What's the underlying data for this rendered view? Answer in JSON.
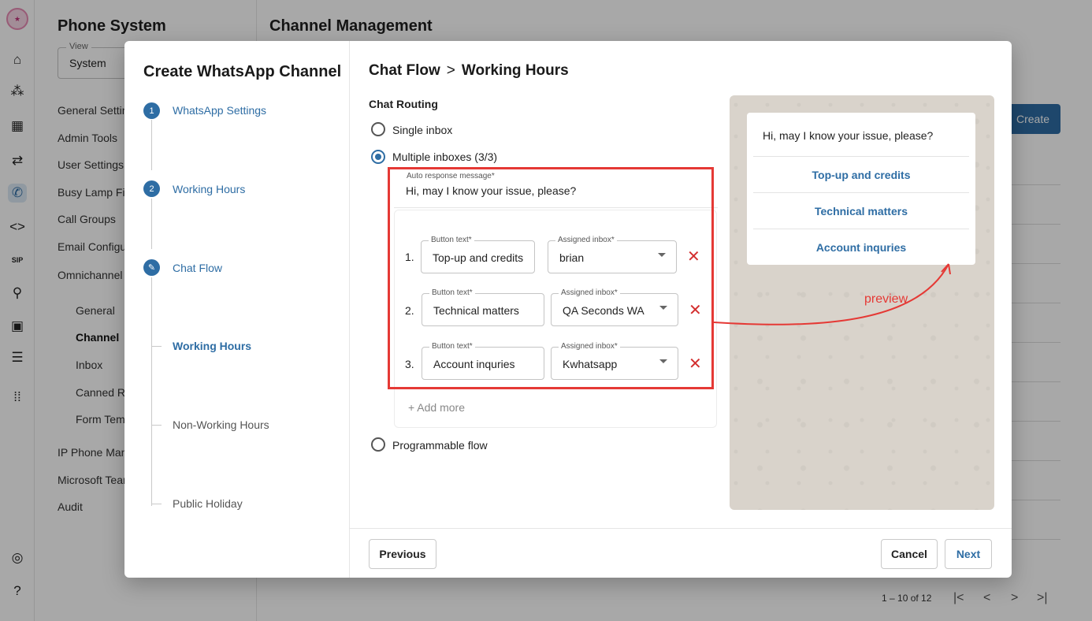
{
  "app": {
    "rail_icons": [
      "logo-icon",
      "home-icon",
      "nodes-icon",
      "dashboard-icon",
      "transfer-icon",
      "phone-icon",
      "code-icon",
      "sip-icon",
      "antenna-icon",
      "contact-icon",
      "server-icon",
      "apps-icon",
      "broadcast-icon",
      "help-icon"
    ],
    "sip_label": "SIP",
    "panel_title": "Phone System",
    "view": {
      "label": "View",
      "value": "System"
    },
    "nav_items": [
      "General Settings",
      "Admin Tools",
      "User Settings",
      "Busy Lamp Field",
      "Call Groups",
      "Email Configuration",
      "Omnichannel"
    ],
    "omnichannel_sub": [
      "General",
      "Channel",
      "Inbox",
      "Canned Responses",
      "Form Templates"
    ],
    "nav_items_after": [
      "IP Phone Management",
      "Microsoft Teams",
      "Audit"
    ],
    "main_title": "Channel Management",
    "create_label": "Create",
    "pager": {
      "range": "1 – 10 of 12",
      "first": "|<",
      "prev": "<",
      "next": ">",
      "last": ">|"
    }
  },
  "modal": {
    "title": "Create WhatsApp Channel",
    "steps": [
      {
        "num": "1",
        "label": "WhatsApp Settings"
      },
      {
        "num": "2",
        "label": "Working Hours"
      },
      {
        "num": "✎",
        "label": "Chat Flow"
      }
    ],
    "substeps": [
      "Working Hours",
      "Non-Working Hours",
      "Public Holiday"
    ],
    "breadcrumb": {
      "parent": "Chat Flow",
      "separator": ">",
      "current": "Working Hours"
    },
    "section_title": "Chat Routing",
    "options": {
      "single": "Single inbox",
      "multiple": "Multiple inboxes (3/3)",
      "programmable": "Programmable flow"
    },
    "auto_response": {
      "label": "Auto response message*",
      "value": "Hi, may I know your issue, please?"
    },
    "button_text_label": "Button text*",
    "assigned_inbox_label": "Assigned inbox*",
    "rows": [
      {
        "num": "1.",
        "text": "Top-up and credits",
        "inbox": "brian"
      },
      {
        "num": "2.",
        "text": "Technical matters",
        "inbox": "QA Seconds WA"
      },
      {
        "num": "3.",
        "text": "Account inquries",
        "inbox": "Kwhatsapp"
      }
    ],
    "remove_glyph": "✕",
    "add_more": "+ Add more",
    "preview": {
      "message": "Hi, may I know your issue, please?",
      "buttons": [
        "Top-up and credits",
        "Technical matters",
        "Account inquries"
      ],
      "annotation": "preview"
    },
    "footer": {
      "previous": "Previous",
      "cancel": "Cancel",
      "next": "Next"
    }
  },
  "colors": {
    "accent": "#2e6da4",
    "annotation": "#e53935",
    "remove": "#d32f2f"
  }
}
